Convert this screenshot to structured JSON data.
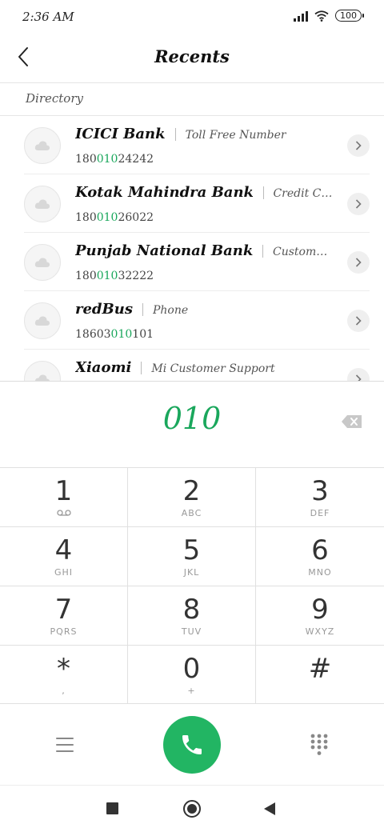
{
  "status": {
    "time": "2:36 AM",
    "battery": "100"
  },
  "header": {
    "title": "Recents"
  },
  "section": {
    "label": "Directory"
  },
  "contacts": [
    {
      "name": "ICICI Bank",
      "desc": "Toll Free Number",
      "num_pre": "180",
      "num_hl": "010",
      "num_post": "24242"
    },
    {
      "name": "Kotak Mahindra Bank",
      "desc": "Credit Card/Banking C...",
      "num_pre": "180",
      "num_hl": "010",
      "num_post": "26022"
    },
    {
      "name": "Punjab National Bank",
      "desc": "Customer Care",
      "num_pre": "180",
      "num_hl": "010",
      "num_post": "32222"
    },
    {
      "name": "redBus",
      "desc": "Phone",
      "num_pre": "18603",
      "num_hl": "010",
      "num_post": "101"
    },
    {
      "name": "Xiaomi",
      "desc": "Mi Customer Support",
      "num_pre": "",
      "num_hl": "",
      "num_post": ""
    }
  ],
  "dialer": {
    "entered": "010"
  },
  "keypad": [
    {
      "digit": "1",
      "letters": ""
    },
    {
      "digit": "2",
      "letters": "ABC"
    },
    {
      "digit": "3",
      "letters": "DEF"
    },
    {
      "digit": "4",
      "letters": "GHI"
    },
    {
      "digit": "5",
      "letters": "JKL"
    },
    {
      "digit": "6",
      "letters": "MNO"
    },
    {
      "digit": "7",
      "letters": "PQRS"
    },
    {
      "digit": "8",
      "letters": "TUV"
    },
    {
      "digit": "9",
      "letters": "WXYZ"
    },
    {
      "digit": "*",
      "letters": ","
    },
    {
      "digit": "0",
      "letters": "+"
    },
    {
      "digit": "#",
      "letters": ""
    }
  ],
  "icons": {
    "back": "chevron-left-icon",
    "avatar": "cloud-icon",
    "row_action": "chevron-right-icon",
    "backspace": "backspace-icon",
    "voicemail": "voicemail-icon",
    "menu": "menu-icon",
    "call": "phone-icon",
    "dialpad": "dialpad-icon"
  },
  "colors": {
    "accent": "#1aa75c",
    "call_button": "#22b563"
  }
}
